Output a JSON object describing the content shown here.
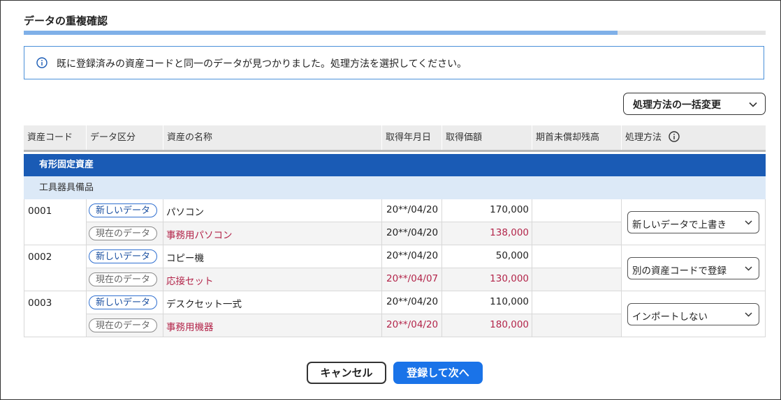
{
  "page": {
    "title": "データの重複確認",
    "progress_pct": 80
  },
  "info": {
    "message": "既に登録済みの資産コードと同一のデータが見つかりました。処理方法を選択してください。"
  },
  "bulk_change": {
    "label": "処理方法の一括変更"
  },
  "table": {
    "headers": {
      "code": "資産コード",
      "type": "データ区分",
      "name": "資産の名称",
      "date": "取得年月日",
      "price": "取得価額",
      "remaining": "期首未償却残高",
      "method": "処理方法"
    },
    "category": "有形固定資産",
    "subcategory": "工具器具備品",
    "groups": [
      {
        "code": "0001",
        "new": {
          "tag": "新しいデータ",
          "name": "パソコン",
          "date": "20**/04/20",
          "price": "170,000"
        },
        "current": {
          "tag": "現在のデータ",
          "name": "事務用パソコン",
          "date": "20**/04/20",
          "price": "138,000"
        },
        "method": "新しいデータで上書き"
      },
      {
        "code": "0002",
        "new": {
          "tag": "新しいデータ",
          "name": "コピー機",
          "date": "20**/04/20",
          "price": "50,000"
        },
        "current": {
          "tag": "現在のデータ",
          "name": "応接セット",
          "date": "20**/04/07",
          "price": "130,000"
        },
        "method": "別の資産コードで登録"
      },
      {
        "code": "0003",
        "new": {
          "tag": "新しいデータ",
          "name": "デスクセット一式",
          "date": "20**/04/20",
          "price": "110,000"
        },
        "current": {
          "tag": "現在のデータ",
          "name": "事務用機器",
          "date": "20**/04/20",
          "price": "180,000"
        },
        "method": "インポートしない"
      }
    ]
  },
  "footer": {
    "cancel_label": "キャンセル",
    "next_label": "登録して次へ"
  },
  "colors": {
    "accent": "#1a73e8",
    "category_bar": "#1a5bb5",
    "subcategory_bar": "#dce9f7",
    "current_data_text": "#b3254a",
    "progress": "#7fb0e8"
  }
}
